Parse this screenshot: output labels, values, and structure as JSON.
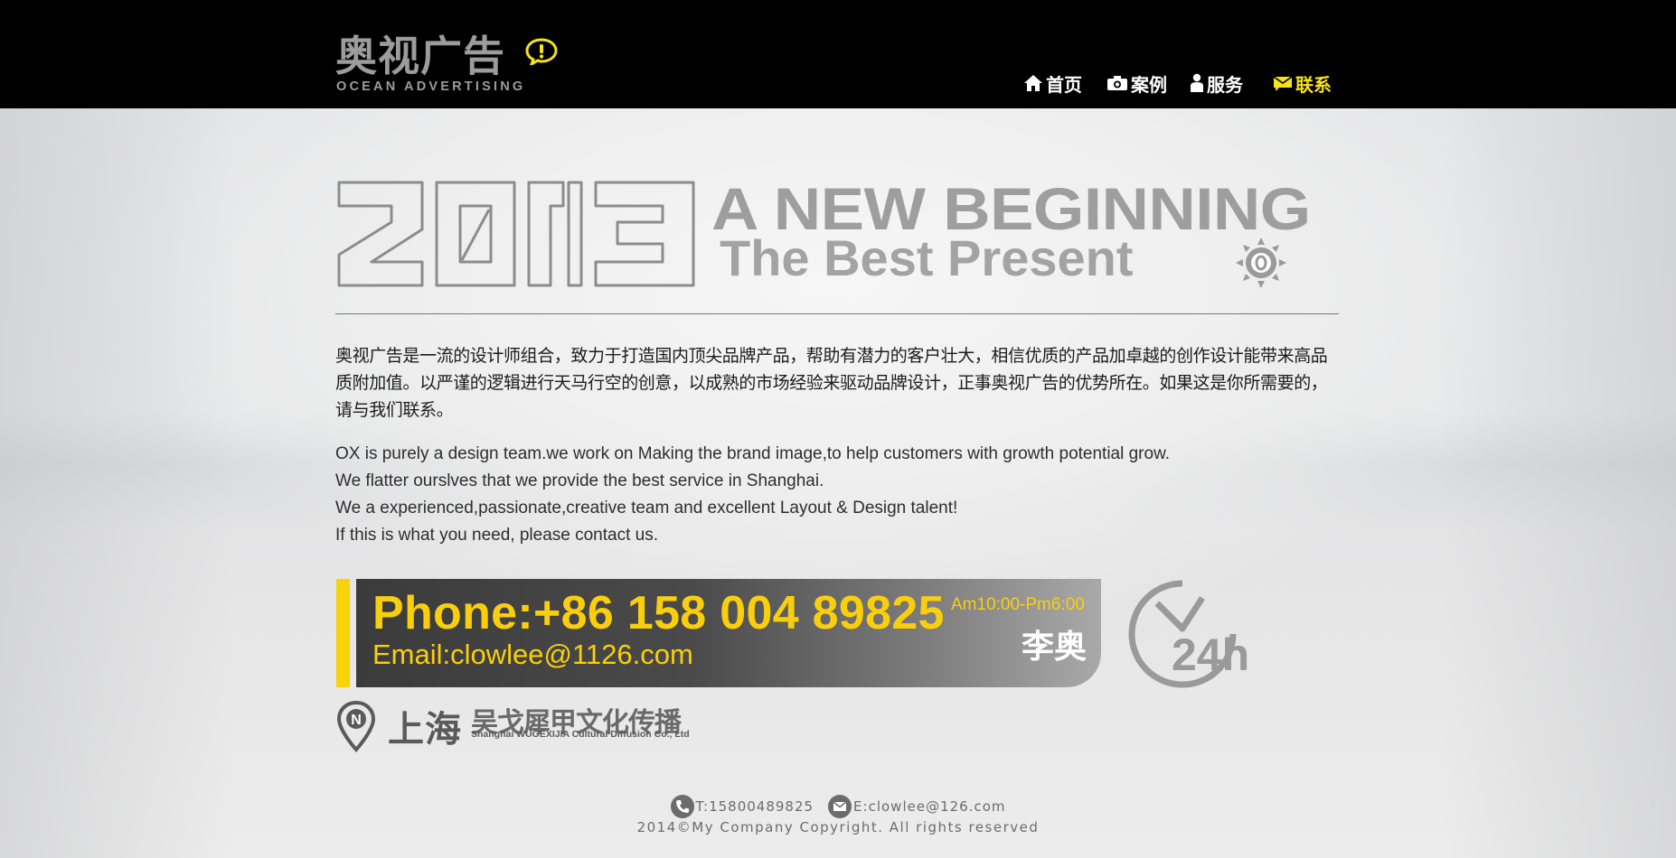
{
  "header": {
    "logo_cn": "奥视广告",
    "logo_en": "OCEAN ADVERTISING",
    "nav": [
      {
        "label": "首页",
        "icon": "home-icon"
      },
      {
        "label": "案例",
        "icon": "camera-icon"
      },
      {
        "label": "服务",
        "icon": "person-icon"
      },
      {
        "label": "联系",
        "icon": "mail-icon",
        "active": true
      }
    ],
    "active_color": "#f4e21b"
  },
  "hero": {
    "year": "2013",
    "line1": "A NEW BEGINNING",
    "line2": "The Best Present"
  },
  "intro_cn": "奥视广告是一流的设计师组合，致力于打造国内顶尖品牌产品，帮助有潜力的客户壮大，相信优质的产品加卓越的创作设计能带来高品质附加值。以严谨的逻辑进行天马行空的创意，以成熟的市场经验来驱动品牌设计，正事奥视广告的优势所在。如果这是你所需要的，请与我们联系。",
  "intro_en": [
    "OX is purely a design team.we work on Making the brand image,to help customers with growth potential grow.",
    "We flatter ourslves that we provide the best service in Shanghai.",
    "We a experienced,passionate,creative team and excellent Layout & Design talent!",
    "If this is what you need, please contact us."
  ],
  "contact": {
    "phone": "Phone:+86 158 004 89825",
    "hours": "Am10:00-Pm6:00",
    "email": "Email:clowlee@1126.com",
    "person": "李奥",
    "clock_label": "24h",
    "accent": "#f9cf0d"
  },
  "company": {
    "city": "上海",
    "name_cn": "吴戈犀甲文化传播",
    "name_en": "Shanghai WUGEXIJIA Cultural Diffusion Co., Ltd",
    "pin_letter": "N"
  },
  "footer": {
    "tel": "T:15800489825",
    "email": "E:clowlee@126.com",
    "copyright": "2014©My Company Copyright. All rights reserved"
  }
}
